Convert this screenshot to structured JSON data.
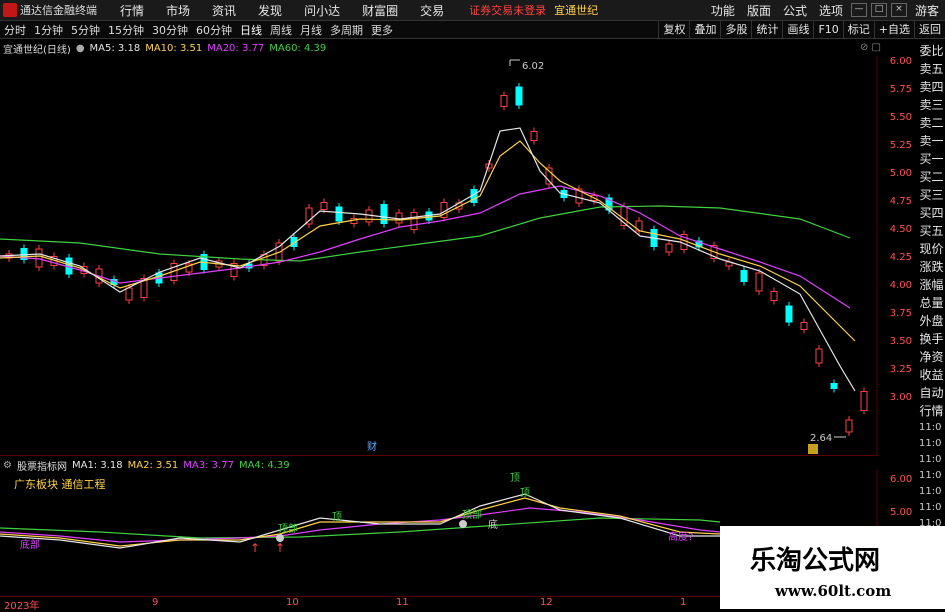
{
  "app": {
    "title": "通达信金融终端",
    "notice": "证券交易未登录",
    "stock_name": "宜通世纪"
  },
  "menu": [
    "行情",
    "市场",
    "资讯",
    "发现",
    "问小达",
    "财富圈",
    "交易"
  ],
  "right_menu": [
    "功能",
    "版面",
    "公式",
    "选项",
    "游客"
  ],
  "periods": [
    "分时",
    "1分钟",
    "5分钟",
    "15分钟",
    "30分钟",
    "60分钟",
    "日线",
    "周线",
    "月线",
    "多周期",
    "更多"
  ],
  "tools": [
    "复权",
    "叠加",
    "多股",
    "统计",
    "画线",
    "F10",
    "标记",
    "+自选",
    "返回"
  ],
  "main_legend": {
    "title": "宜通世纪(日线)",
    "ma5": "MA5: 3.18",
    "ma10": "MA10: 3.51",
    "ma20": "MA20: 3.77",
    "ma60": "MA60: 4.39"
  },
  "price_axis": [
    "6.00",
    "5.75",
    "5.50",
    "5.25",
    "5.00",
    "4.75",
    "4.50",
    "4.25",
    "4.00",
    "3.75",
    "3.50",
    "3.25",
    "3.00"
  ],
  "peak_label": "6.02",
  "trough_label": "2.64",
  "cai_label": "财",
  "sidebar": [
    "委比",
    "卖五",
    "卖四",
    "卖三",
    "卖二",
    "卖一",
    "买一",
    "买二",
    "买三",
    "买四",
    "买五",
    "现价",
    "涨跌",
    "涨幅",
    "总量",
    "外盘",
    "换手",
    "净资",
    "收益",
    "自动",
    "行情"
  ],
  "time_side": [
    "11:0",
    "11:0",
    "11:0",
    "11:0",
    "11:0",
    "11:0",
    "11:0"
  ],
  "indicator_legend": {
    "title": "股票指标网",
    "ma1": "MA1: 3.18",
    "ma2": "MA2: 3.51",
    "ma3": "MA3: 3.77",
    "ma4": "MA4: 4.39"
  },
  "indicator_sub": "广东板块  通信工程",
  "indicator_axis": [
    "6.00",
    "5.00"
  ],
  "signals": {
    "top": "顶",
    "top_part": "顶部",
    "bottom_part": "底部",
    "bottom": "底",
    "peak": "顶",
    "trend": "高度?"
  },
  "x_labels": [
    "2023年",
    "9",
    "10",
    "11",
    "12",
    "1"
  ],
  "watermark": {
    "title": "乐淘公式网",
    "url": "www.60lt.com"
  },
  "colors": {
    "up": "#ff4040",
    "down": "#00ffff",
    "ma5": "#e6e6e6",
    "ma10": "#ffd24a",
    "ma20": "#e040ff",
    "ma60": "#40d040"
  }
}
